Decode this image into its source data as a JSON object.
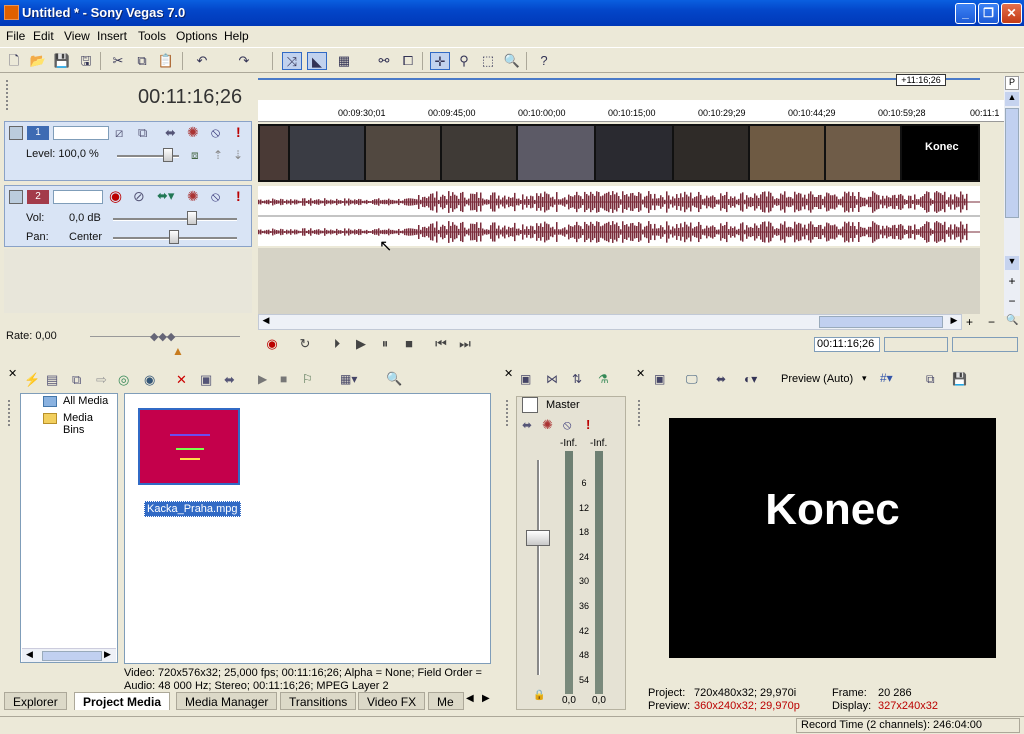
{
  "window": {
    "title": "Untitled * - Sony Vegas 7.0"
  },
  "menu": [
    "File",
    "Edit",
    "View",
    "Insert",
    "Tools",
    "Options",
    "Help"
  ],
  "timeline": {
    "cursor_time": "00:11:16;26",
    "cursor_badge": "+11:16;26",
    "ruler_labels": [
      "00:09:30;01",
      "00:09:45;00",
      "00:10:00;00",
      "00:10:15;00",
      "00:10:29;29",
      "00:10:44;29",
      "00:10:59;28",
      "00:11:1"
    ],
    "video_end_text": "Konec"
  },
  "tracks": {
    "video": {
      "number": "1",
      "level_label": "Level: 100,0 %"
    },
    "audio": {
      "number": "2",
      "vol_label": "Vol:",
      "vol_value": "0,0 dB",
      "pan_label": "Pan:",
      "pan_value": "Center"
    }
  },
  "transport": {
    "rate_label": "Rate: 0,00",
    "time": "00:11:16;26"
  },
  "explorer": {
    "tree": [
      "All Media",
      "Media Bins"
    ],
    "media_file": "Kacka_Praha.mpg",
    "info_video": "Video: 720x576x32; 25,000 fps; 00:11:16;26; Alpha = None; Field Order =",
    "info_audio": "Audio: 48 000 Hz; Stereo; 00:11:16;26; MPEG Layer 2"
  },
  "tabs": [
    "Explorer",
    "Project Media",
    "Media Manager",
    "Transitions",
    "Video FX",
    "Me"
  ],
  "mixer": {
    "title": "Master",
    "peak_left": "-Inf.",
    "peak_right": "-Inf.",
    "scale": [
      "6",
      "12",
      "18",
      "24",
      "30",
      "36",
      "42",
      "48",
      "54"
    ],
    "value_left": "0,0",
    "value_right": "0,0"
  },
  "preview": {
    "mode": "Preview (Auto)",
    "screen_text": "Konec",
    "project_label": "Project:",
    "project_value": "720x480x32; 29,970i",
    "preview_label": "Preview:",
    "preview_value": "360x240x32; 29,970p",
    "frame_label": "Frame:",
    "frame_value": "20 286",
    "display_label": "Display:",
    "display_value": "327x240x32"
  },
  "status": {
    "record_time": "Record Time (2 channels): 246:04:00"
  }
}
